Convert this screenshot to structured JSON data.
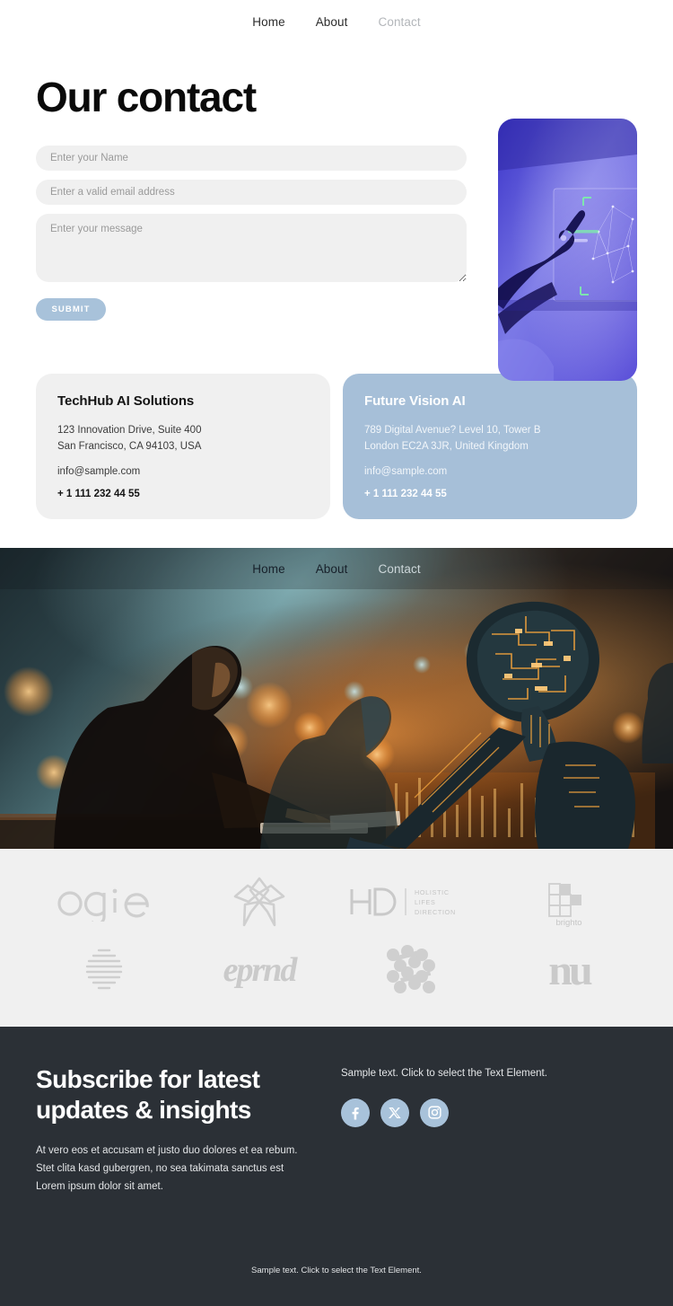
{
  "nav": {
    "items": [
      {
        "label": "Home",
        "muted": false
      },
      {
        "label": "About",
        "muted": false
      },
      {
        "label": "Contact",
        "muted": true
      }
    ]
  },
  "contact": {
    "title": "Our contact",
    "form": {
      "name_placeholder": "Enter your Name",
      "name_value": "",
      "email_placeholder": "Enter a valid email address",
      "email_value": "",
      "message_placeholder": "Enter your message",
      "message_value": "",
      "submit_label": "SUBMIT"
    },
    "hero_image_alt": "hand-touching-holographic-screen"
  },
  "cards": [
    {
      "title": "TechHub AI Solutions",
      "address_line1": "123 Innovation Drive, Suite 400",
      "address_line2": "San Francisco, CA 94103, USA",
      "email": "info@sample.com",
      "phone": "+ 1 111 232 44 55"
    },
    {
      "title": "Future Vision AI",
      "address_line1": "789 Digital Avenue? Level 10, Tower B",
      "address_line2": "London EC2A 3JR, United Kingdom",
      "email": "info@sample.com",
      "phone": "+ 1 111 232 44 55"
    }
  ],
  "hero_band": {
    "image_alt": "woman-at-desk-with-robot-city-lights",
    "nav": [
      {
        "label": "Home",
        "muted": false
      },
      {
        "label": "About",
        "muted": false
      },
      {
        "label": "Contact",
        "muted": true
      }
    ]
  },
  "logos": [
    {
      "name": "ogie",
      "text": "ogie"
    },
    {
      "name": "flower-star",
      "text": ""
    },
    {
      "name": "hd-holistic-lifes-direction",
      "text": "HD",
      "sub1": "HOLISTIC",
      "sub2": "LIFES",
      "sub3": "DIRECTION"
    },
    {
      "name": "brighto",
      "text": "brighto"
    },
    {
      "name": "striped-sphere",
      "text": ""
    },
    {
      "name": "eprnd-script",
      "text": "eprnd"
    },
    {
      "name": "dot-cluster",
      "text": ""
    },
    {
      "name": "nu-serif",
      "text": "nu"
    }
  ],
  "footer": {
    "title_line1": "Subscribe for latest",
    "title_line2": "updates & insights",
    "text_line1": "At vero eos et accusam et justo duo dolores et ea rebum.",
    "text_line2": "Stet clita kasd gubergren, no sea takimata sanctus est",
    "text_line3": "Lorem ipsum dolor sit amet.",
    "sample_text": "Sample text. Click to select the Text Element.",
    "socials": [
      {
        "name": "facebook",
        "label": "Facebook"
      },
      {
        "name": "x-twitter",
        "label": "X"
      },
      {
        "name": "instagram",
        "label": "Instagram"
      }
    ],
    "bottom_text": "Sample text. Click to select the Text Element."
  },
  "colors": {
    "accent_blue": "#a8c2da",
    "card_blue": "#a6bfd8",
    "card_gray": "#f0f0f0",
    "footer_dark": "#2b3036",
    "logo_band": "#f0f0f0",
    "text_dark": "#0a0a0a",
    "muted_nav": "#b3b6ba"
  }
}
